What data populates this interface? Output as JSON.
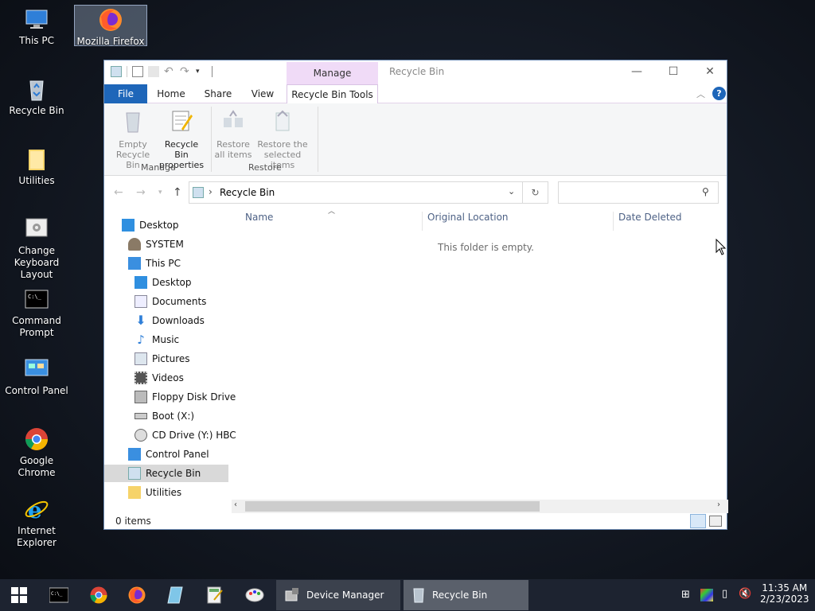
{
  "desktop": {
    "icons": [
      {
        "label": "This PC"
      },
      {
        "label": "Mozilla Firefox"
      },
      {
        "label": "Recycle Bin"
      },
      {
        "label": "Utilities"
      },
      {
        "label": "Change Keyboard Layout"
      },
      {
        "label": "Command Prompt"
      },
      {
        "label": "Control Panel"
      },
      {
        "label": "Google Chrome"
      },
      {
        "label": "Internet Explorer"
      }
    ]
  },
  "window": {
    "title": "Recycle Bin",
    "context_tab": "Manage",
    "tabs": {
      "file": "File",
      "home": "Home",
      "share": "Share",
      "view": "View",
      "tools": "Recycle Bin Tools"
    },
    "ribbon": {
      "empty_line1": "Empty",
      "empty_line2": "Recycle Bin",
      "props_line1": "Recycle Bin",
      "props_line2": "properties",
      "restore_all_line1": "Restore",
      "restore_all_line2": "all items",
      "restore_sel_line1": "Restore the",
      "restore_sel_line2": "selected items",
      "group_manage": "Manage",
      "group_restore": "Restore"
    },
    "address": {
      "path": "Recycle Bin",
      "search_placeholder": ""
    },
    "nav": [
      {
        "label": "Desktop"
      },
      {
        "label": "SYSTEM"
      },
      {
        "label": "This PC"
      },
      {
        "label": "Desktop"
      },
      {
        "label": "Documents"
      },
      {
        "label": "Downloads"
      },
      {
        "label": "Music"
      },
      {
        "label": "Pictures"
      },
      {
        "label": "Videos"
      },
      {
        "label": "Floppy Disk Drive"
      },
      {
        "label": "Boot (X:)"
      },
      {
        "label": "CD Drive (Y:) HBC"
      },
      {
        "label": "Control Panel"
      },
      {
        "label": "Recycle Bin"
      },
      {
        "label": "Utilities"
      }
    ],
    "columns": {
      "name": "Name",
      "original_location": "Original Location",
      "date_deleted": "Date Deleted"
    },
    "empty_message": "This folder is empty.",
    "status": "0 items"
  },
  "taskbar": {
    "apps": {
      "device_manager": "Device Manager",
      "recycle_bin": "Recycle Bin"
    },
    "time": "11:35 AM",
    "date": "2/23/2023"
  }
}
